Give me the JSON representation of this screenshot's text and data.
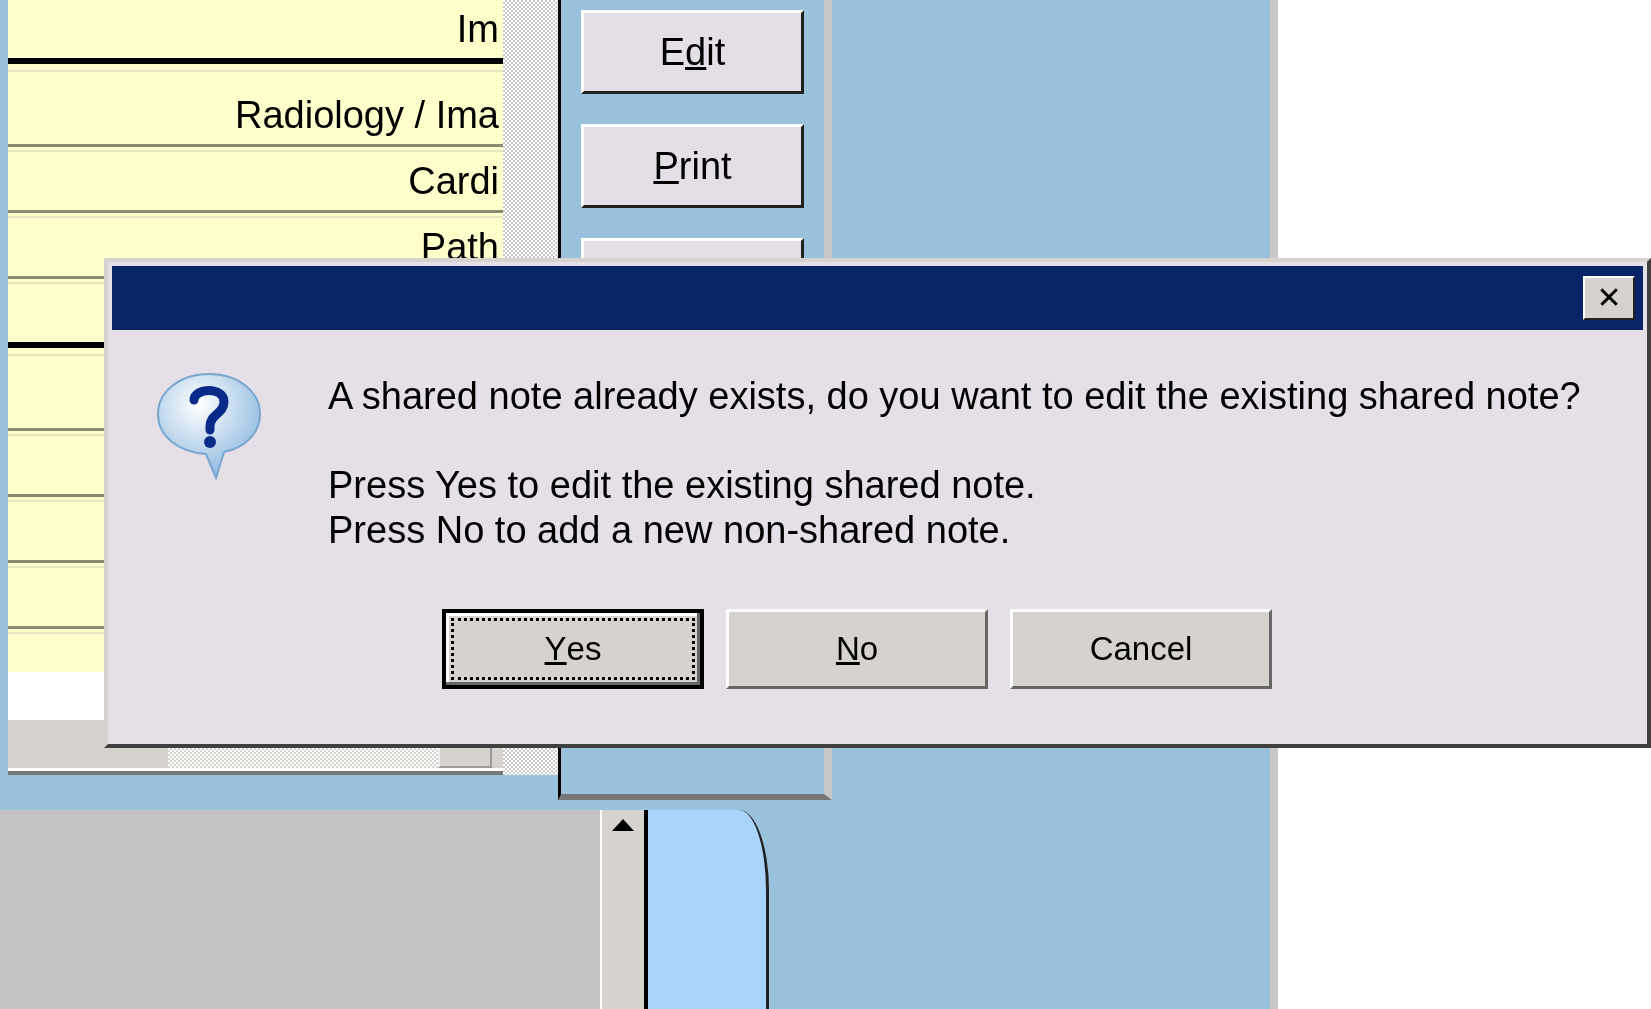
{
  "list_rows": [
    {
      "text": "Im",
      "thick_rule_after": true
    },
    {
      "text": "Radiology / Ima",
      "thick_rule_after": false
    },
    {
      "text": "Cardi",
      "thick_rule_after": false
    },
    {
      "text": "Path",
      "thick_rule_after": false
    },
    {
      "thick_rule_after": true
    },
    {
      "thick_rule_after": false
    },
    {
      "thick_rule_after": false
    },
    {
      "thick_rule_after": false
    },
    {
      "thick_rule_after": false
    }
  ],
  "toolbar_buttons": [
    {
      "before": "E",
      "key": "d",
      "after": "it"
    },
    {
      "key": "P",
      "after": "rint"
    }
  ],
  "dialog": {
    "message": "A shared note already exists, do you want to edit the existing shared note?",
    "detail_lines": [
      "Press Yes to edit the existing shared note.",
      "Press No to add a new non-shared note."
    ],
    "close_label": "✕",
    "buttons": [
      {
        "key": "Y",
        "after": "es",
        "default": true
      },
      {
        "key": "N",
        "after": "o",
        "default": false
      },
      {
        "before": "Cancel",
        "default": false
      }
    ]
  }
}
